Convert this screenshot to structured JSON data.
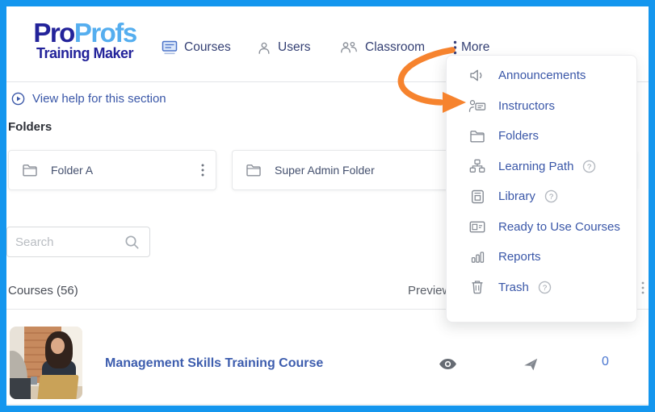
{
  "brand": {
    "pro": "Pro",
    "profs": "Profs",
    "sub": "Training Maker"
  },
  "nav": {
    "courses": "Courses",
    "users": "Users",
    "classroom": "Classroom",
    "more": "More"
  },
  "help_link": {
    "label": "View help for this section"
  },
  "folders": {
    "title": "Folders",
    "cards": [
      {
        "name": "Folder A"
      },
      {
        "name": "Super Admin Folder"
      }
    ]
  },
  "search": {
    "placeholder": "Search"
  },
  "courses_list": {
    "header": "Courses (56)",
    "preview_column": "Preview",
    "rows": [
      {
        "title": "Management Skills Training Course",
        "assign_count": "0"
      }
    ]
  },
  "dropdown": {
    "items": [
      {
        "label": "Announcements",
        "has_help": false
      },
      {
        "label": "Instructors",
        "has_help": false
      },
      {
        "label": "Folders",
        "has_help": false
      },
      {
        "label": "Learning Path",
        "has_help": true
      },
      {
        "label": "Library",
        "has_help": true
      },
      {
        "label": "Ready to Use Courses",
        "has_help": false
      },
      {
        "label": "Reports",
        "has_help": false
      },
      {
        "label": "Trash",
        "has_help": true
      }
    ]
  },
  "glyphs": {
    "question": "?"
  },
  "colors": {
    "frame_blue": "#1496ee",
    "brand_dark": "#23239a",
    "brand_light": "#55aeef",
    "nav_text": "#333f73",
    "link_blue": "#3a57a8",
    "orange_arrow": "#f6832e",
    "course_title_blue": "#3d5dae",
    "count_blue": "#4a76d0",
    "icon_gray": "#858b94"
  }
}
